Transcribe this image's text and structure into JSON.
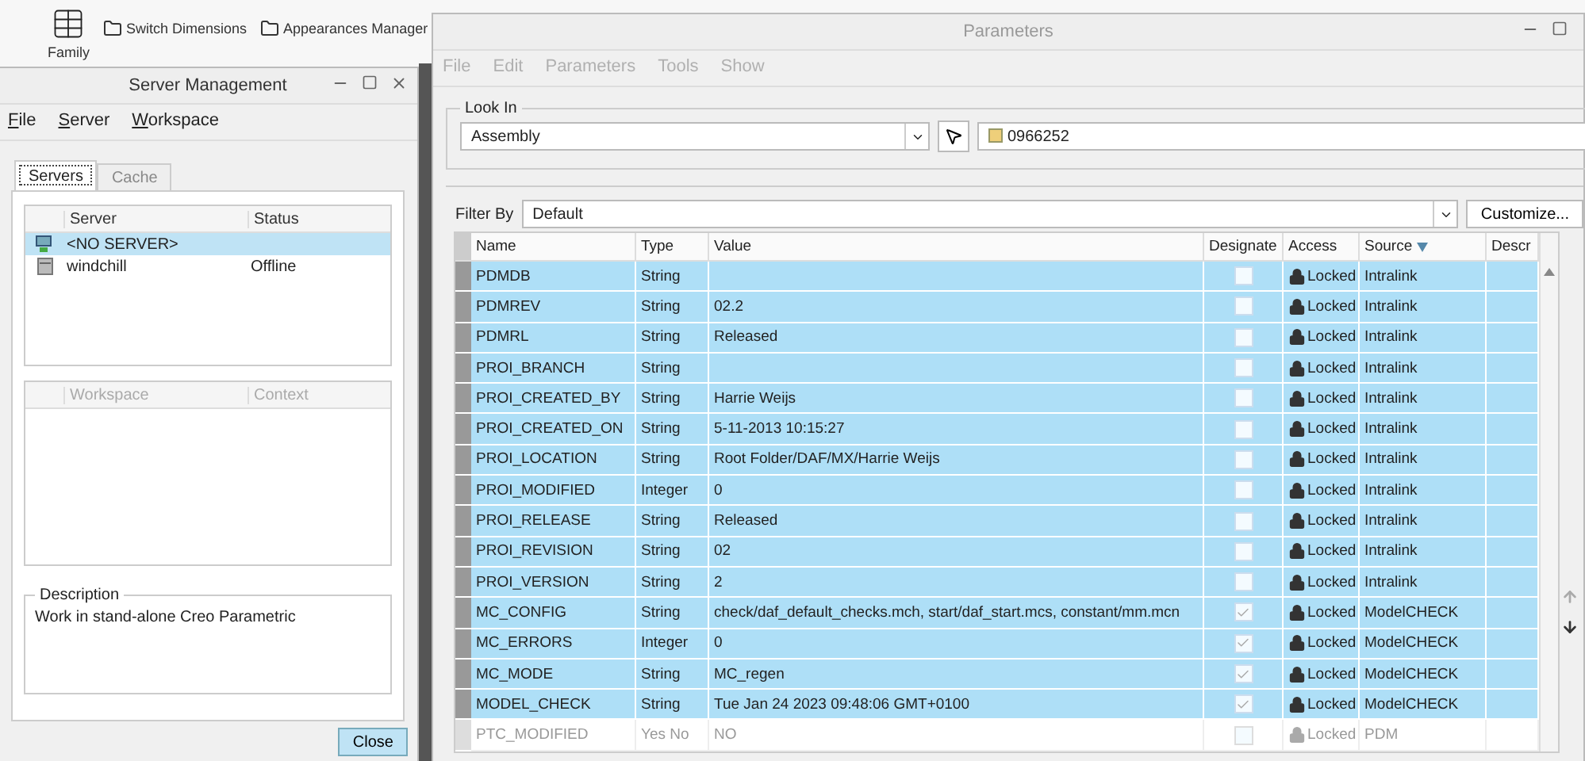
{
  "ribbon": {
    "items": [
      {
        "label": "Family",
        "kind": "large"
      },
      {
        "label": "Switch Dimensions",
        "kind": "small"
      },
      {
        "label": "Appearances Manager",
        "kind": "small"
      }
    ]
  },
  "server_window": {
    "title": "Server Management",
    "menu": [
      "File",
      "Server",
      "Workspace"
    ],
    "tabs": [
      {
        "label": "Servers",
        "selected": true
      },
      {
        "label": "Cache",
        "selected": false
      }
    ],
    "servers": {
      "columns": [
        "Server",
        "Status"
      ],
      "rows": [
        {
          "name": "<NO SERVER>",
          "status": "",
          "kind": "network",
          "selected": true
        },
        {
          "name": "windchill",
          "status": "Offline",
          "kind": "server",
          "selected": false
        }
      ]
    },
    "workspaces": {
      "columns": [
        "Workspace",
        "Context"
      ],
      "disabled": true
    },
    "description": {
      "label": "Description",
      "text": "Work in stand-alone Creo Parametric"
    },
    "close_button": "Close"
  },
  "parameters_window": {
    "title": "Parameters",
    "menu": [
      {
        "label": "File",
        "disabled": true
      },
      {
        "label": "Edit",
        "disabled": true
      },
      {
        "label": "Parameters",
        "disabled": true
      },
      {
        "label": "Tools",
        "disabled": true
      },
      {
        "label": "Show",
        "disabled": true
      }
    ],
    "look_in": {
      "label": "Look In",
      "scope": "Assembly",
      "model": "0966252"
    },
    "filter": {
      "label": "Filter By",
      "value": "Default",
      "button": "Customize..."
    },
    "table": {
      "columns": [
        "Name",
        "Type",
        "Value",
        "Designate",
        "Access",
        "Source",
        "Descr"
      ],
      "rows": [
        {
          "name": "PDMDB",
          "type": "String",
          "value": "",
          "designate": false,
          "access": "Locked",
          "source": "Intralink",
          "selected": true
        },
        {
          "name": "PDMREV",
          "type": "String",
          "value": "02.2",
          "designate": false,
          "access": "Locked",
          "source": "Intralink",
          "selected": true
        },
        {
          "name": "PDMRL",
          "type": "String",
          "value": "Released",
          "designate": false,
          "access": "Locked",
          "source": "Intralink",
          "selected": true
        },
        {
          "name": "PROI_BRANCH",
          "type": "String",
          "value": "",
          "designate": false,
          "access": "Locked",
          "source": "Intralink",
          "selected": true
        },
        {
          "name": "PROI_CREATED_BY",
          "type": "String",
          "value": "Harrie Weijs",
          "designate": false,
          "access": "Locked",
          "source": "Intralink",
          "selected": true
        },
        {
          "name": "PROI_CREATED_ON",
          "type": "String",
          "value": "5-11-2013 10:15:27",
          "designate": false,
          "access": "Locked",
          "source": "Intralink",
          "selected": true
        },
        {
          "name": "PROI_LOCATION",
          "type": "String",
          "value": "Root Folder/DAF/MX/Harrie Weijs",
          "designate": false,
          "access": "Locked",
          "source": "Intralink",
          "selected": true
        },
        {
          "name": "PROI_MODIFIED",
          "type": "Integer",
          "value": "0",
          "designate": false,
          "access": "Locked",
          "source": "Intralink",
          "selected": true
        },
        {
          "name": "PROI_RELEASE",
          "type": "String",
          "value": "Released",
          "designate": false,
          "access": "Locked",
          "source": "Intralink",
          "selected": true
        },
        {
          "name": "PROI_REVISION",
          "type": "String",
          "value": "02",
          "designate": false,
          "access": "Locked",
          "source": "Intralink",
          "selected": true
        },
        {
          "name": "PROI_VERSION",
          "type": "String",
          "value": "2",
          "designate": false,
          "access": "Locked",
          "source": "Intralink",
          "selected": true
        },
        {
          "name": "MC_CONFIG",
          "type": "String",
          "value": "check/daf_default_checks.mch, start/daf_start.mcs, constant/mm.mcn",
          "designate": true,
          "access": "Locked",
          "source": "ModelCHECK",
          "selected": true
        },
        {
          "name": "MC_ERRORS",
          "type": "Integer",
          "value": "0",
          "designate": true,
          "access": "Locked",
          "source": "ModelCHECK",
          "selected": true
        },
        {
          "name": "MC_MODE",
          "type": "String",
          "value": "MC_regen",
          "designate": true,
          "access": "Locked",
          "source": "ModelCHECK",
          "selected": true
        },
        {
          "name": "MODEL_CHECK",
          "type": "String",
          "value": "Tue Jan 24 2023 09:48:06 GMT+0100",
          "designate": true,
          "access": "Locked",
          "source": "ModelCHECK",
          "selected": true
        },
        {
          "name": "PTC_MODIFIED",
          "type": "Yes No",
          "value": "NO",
          "designate": false,
          "access": "Locked",
          "source": "PDM",
          "selected": false
        }
      ]
    }
  }
}
